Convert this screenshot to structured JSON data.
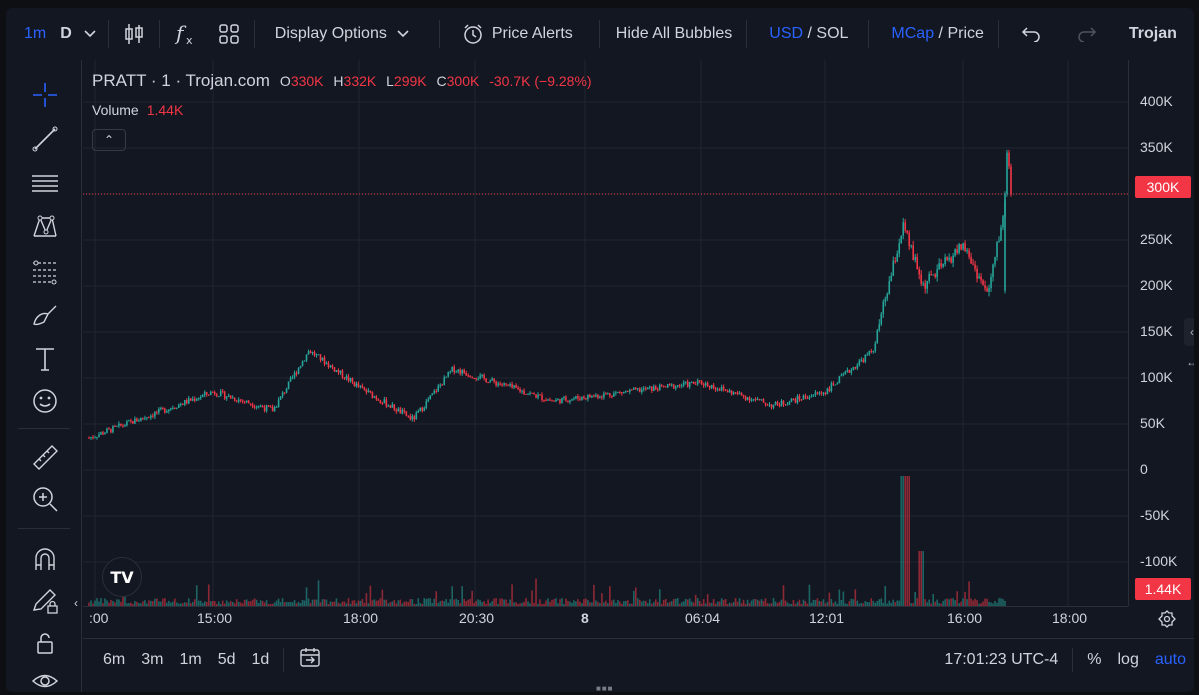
{
  "topbar": {
    "interval": "1m",
    "interval_secondary": "D",
    "display_options": "Display Options",
    "price_alerts": "Price Alerts",
    "hide_bubbles": "Hide All Bubbles",
    "currency_active": "USD",
    "currency_sep": " / ",
    "currency_other": "SOL",
    "mode_active": "MCap",
    "mode_sep": " / ",
    "mode_other": "Price",
    "brand": "Trojan",
    "icons": [
      "candles-icon",
      "indicators-icon",
      "layouts-icon",
      "alarm-clock-icon",
      "undo-icon",
      "redo-icon"
    ]
  },
  "legend": {
    "symbol": "PRATT · 1 · Trojan.com",
    "o_label": "O",
    "o_val": "330K",
    "h_label": "H",
    "h_val": "332K",
    "l_label": "L",
    "l_val": "299K",
    "c_label": "C",
    "c_val": "300K",
    "change": "-30.7K (−9.28%)",
    "volume_label": "Volume",
    "volume_val": "1.44K"
  },
  "price_axis": {
    "ticks": [
      "400K",
      "350K",
      "300K",
      "250K",
      "200K",
      "150K",
      "100K",
      "50K",
      "0",
      "-50K",
      "-100K"
    ],
    "current_price": "300K",
    "current_volume": "1.44K"
  },
  "time_axis": {
    "ticks": [
      ":00",
      "15:00",
      "18:00",
      "20:30",
      "8",
      "06:04",
      "12:01",
      "16:00",
      "18:00"
    ]
  },
  "bottombar": {
    "ranges": [
      "6m",
      "3m",
      "1m",
      "5d",
      "1d"
    ],
    "clock": "17:01:23 UTC-4",
    "percent": "%",
    "log": "log",
    "auto": "auto"
  },
  "colors": {
    "up": "#26a69a",
    "down": "#f23645",
    "accent": "#2962ff",
    "background": "#131722"
  },
  "chart_data": {
    "type": "candlestick",
    "title": "PRATT · 1 · Trojan.com",
    "ylabel": "",
    "ylim": [
      -125000,
      425000
    ],
    "close_series": [
      {
        "t": ":00",
        "v": 35000
      },
      {
        "t": "15:00",
        "v": 85000
      },
      {
        "t": "16:30",
        "v": 65000
      },
      {
        "t": "17:00",
        "v": 130000
      },
      {
        "t": "18:00",
        "v": 90000
      },
      {
        "t": "20:00",
        "v": 55000
      },
      {
        "t": "20:30",
        "v": 110000
      },
      {
        "t": "8",
        "v": 75000
      },
      {
        "t": "06:04",
        "v": 95000
      },
      {
        "t": "09:00",
        "v": 70000
      },
      {
        "t": "12:01",
        "v": 85000
      },
      {
        "t": "13:00",
        "v": 130000
      },
      {
        "t": "14:00",
        "v": 265000
      },
      {
        "t": "14:30",
        "v": 200000
      },
      {
        "t": "16:00",
        "v": 245000
      },
      {
        "t": "16:30",
        "v": 190000
      },
      {
        "t": "17:01",
        "v": 300000
      }
    ],
    "last_open": 330000,
    "last_high": 332000,
    "last_low": 299000,
    "last_close": 300000,
    "volume_last": 1440
  }
}
